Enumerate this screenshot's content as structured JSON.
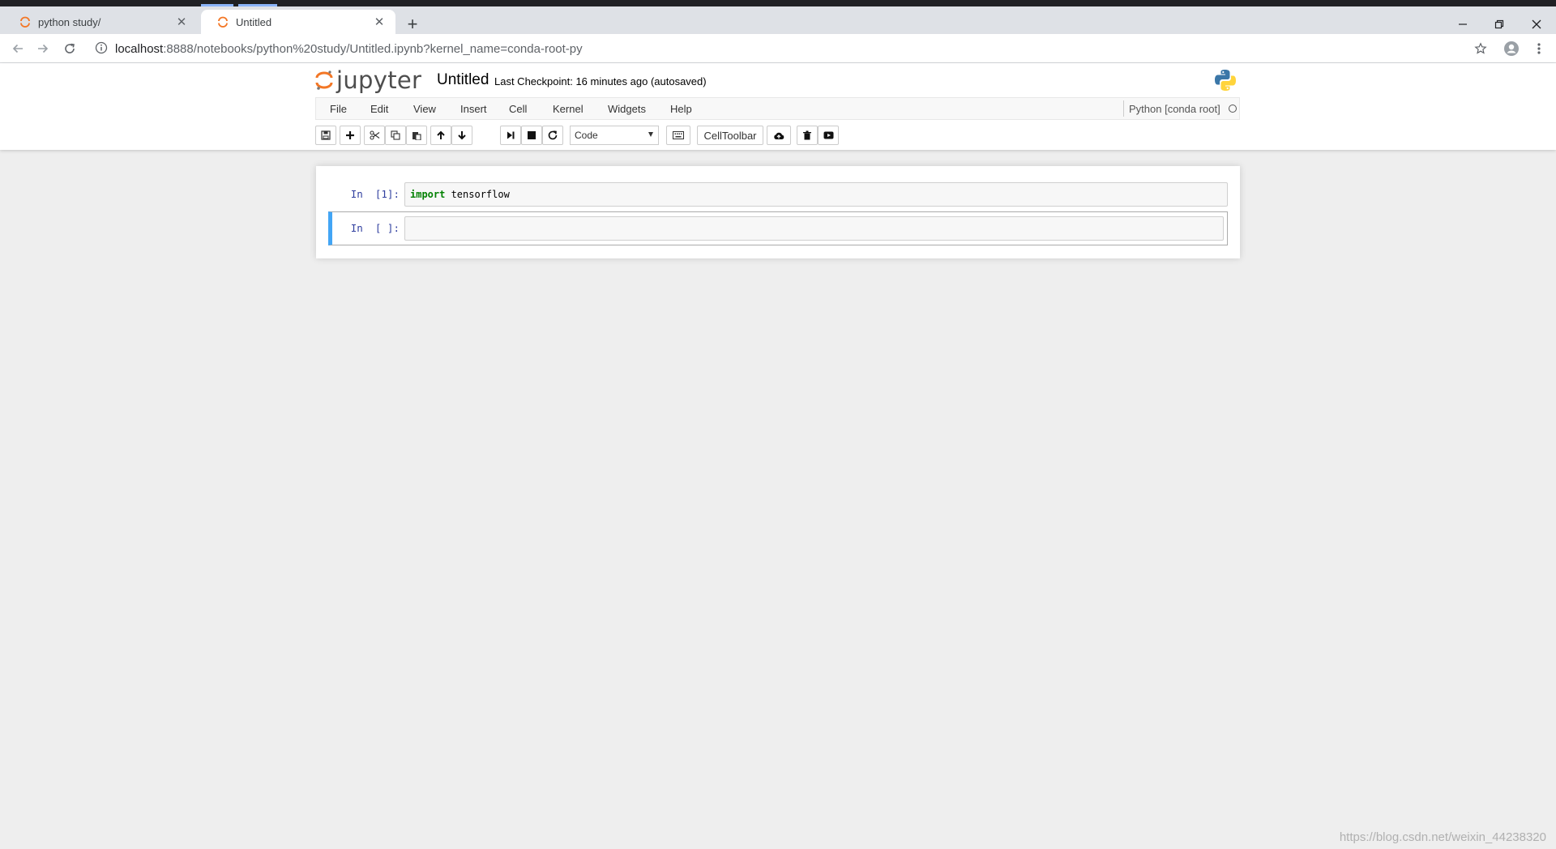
{
  "browser": {
    "tabs": [
      {
        "title": "python study/",
        "active": false
      },
      {
        "title": "Untitled",
        "active": true
      }
    ],
    "new_tab": "+",
    "url_host": "localhost",
    "url_rest": ":8888/notebooks/python%20study/Untitled.ipynb?kernel_name=conda-root-py"
  },
  "header": {
    "logo_text": "jupyter",
    "notebook_name": "Untitled",
    "checkpoint": "Last Checkpoint: 16 minutes ago (autosaved)"
  },
  "menu": {
    "items": [
      "File",
      "Edit",
      "View",
      "Insert",
      "Cell",
      "Kernel",
      "Widgets",
      "Help"
    ],
    "kernel_name": "Python [conda root]"
  },
  "toolbar": {
    "cell_type": "Code",
    "celltoolbar_label": "CellToolbar"
  },
  "cells": [
    {
      "prompt": "In  [1]:",
      "keyword": "import",
      "code_rest": " tensorflow"
    },
    {
      "prompt": "In  [ ]:",
      "code": ""
    }
  ],
  "watermark": "https://blog.csdn.net/weixin_44238320",
  "colors": {
    "jupyter_orange": "#f37726",
    "selected_cell_border": "#42a5f5",
    "prompt_blue": "#303f9f",
    "keyword_green": "#008000"
  }
}
